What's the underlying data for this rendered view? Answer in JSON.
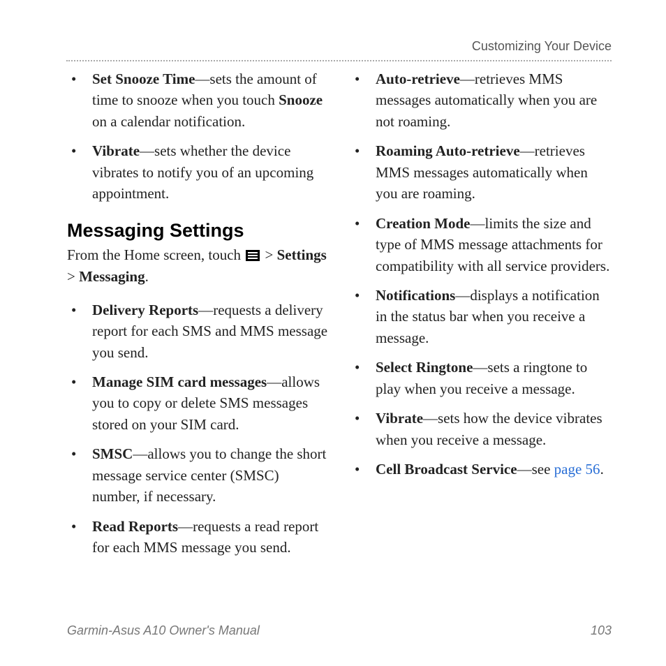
{
  "header": {
    "section": "Customizing Your Device"
  },
  "left": {
    "top_items": [
      {
        "term": "Set Snooze Time",
        "desc_a": "—sets the amount of time to snooze when you touch ",
        "inner_bold": "Snooze",
        "desc_b": " on a calendar notification."
      },
      {
        "term": "Vibrate",
        "desc_a": "—sets whether the device vibrates to notify you of an upcoming appointment.",
        "inner_bold": "",
        "desc_b": ""
      }
    ],
    "heading": "Messaging Settings",
    "intro_a": "From the Home screen, touch ",
    "intro_b": " > ",
    "intro_settings": "Settings",
    "intro_gt": " > ",
    "intro_messaging": "Messaging",
    "intro_period": ".",
    "items": [
      {
        "term": "Delivery Reports",
        "desc": "—requests a delivery report for each SMS and MMS message you send."
      },
      {
        "term": "Manage SIM card messages",
        "desc": "—allows you to copy or delete SMS messages stored on your SIM card."
      },
      {
        "term": "SMSC",
        "desc": "—allows you to change the short message service center (SMSC) number, if necessary."
      },
      {
        "term": "Read Reports",
        "desc": "—requests a read report for each MMS message you send."
      }
    ]
  },
  "right": {
    "items": [
      {
        "term": "Auto-retrieve",
        "desc": "—retrieves MMS messages automatically when you are not roaming."
      },
      {
        "term": "Roaming Auto-retrieve",
        "desc": "—retrieves MMS messages automatically when you are roaming."
      },
      {
        "term": "Creation Mode",
        "desc": "—limits the size and type of MMS message attachments for compatibility with all service providers."
      },
      {
        "term": "Notifications",
        "desc": "—displays a notification in the status bar when you receive a message."
      },
      {
        "term": "Select Ringtone",
        "desc": "—sets a ringtone to play when you receive a message."
      },
      {
        "term": "Vibrate",
        "desc": "—sets how the device vibrates when you receive a message."
      }
    ],
    "last": {
      "term": "Cell Broadcast Service",
      "dash": "—see ",
      "link": "page 56",
      "period": "."
    }
  },
  "footer": {
    "left": "Garmin-Asus A10 Owner's Manual",
    "right": "103"
  }
}
